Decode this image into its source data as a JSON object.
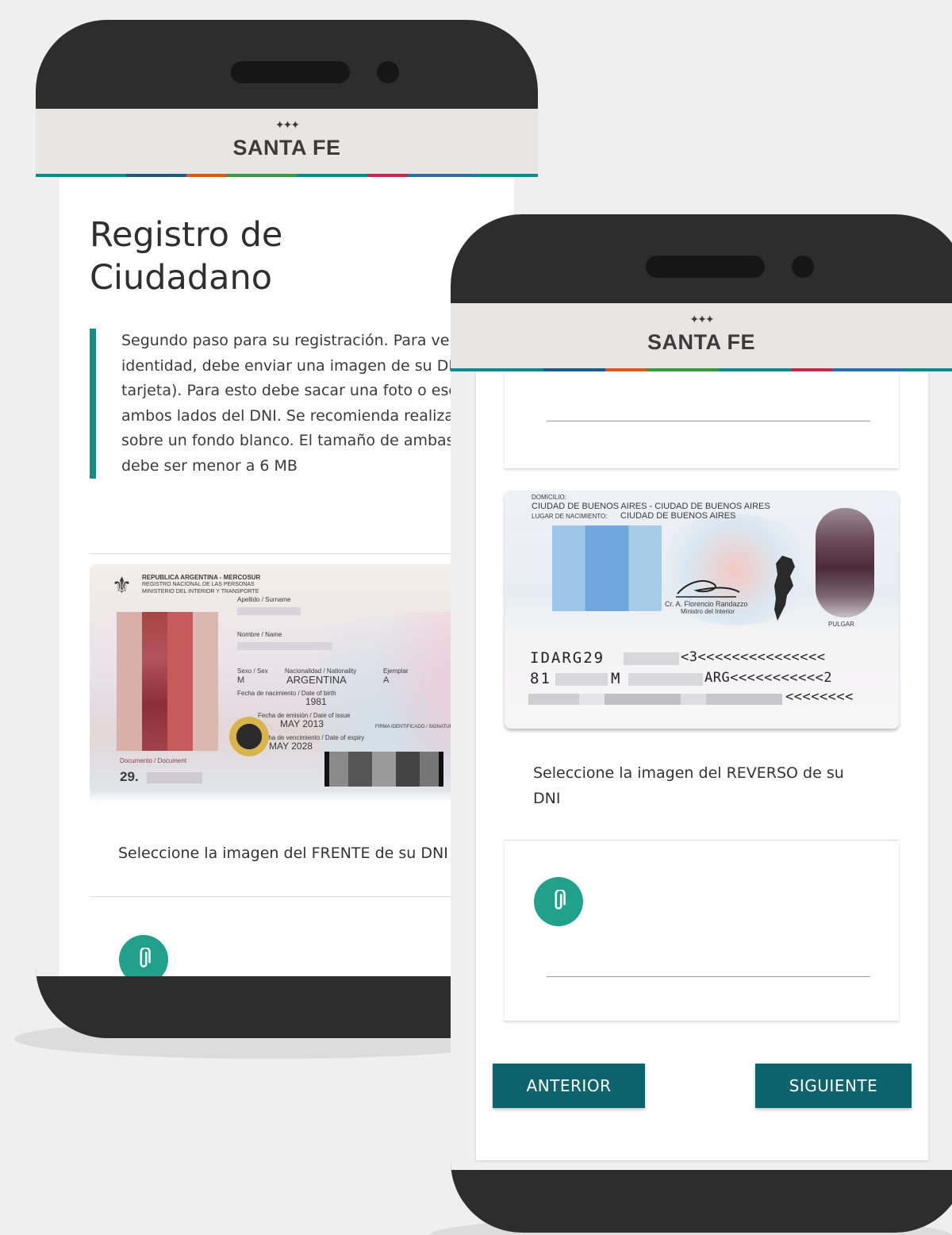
{
  "brand": {
    "name": "SANTA FE",
    "stars": "✦✦✦"
  },
  "phone1": {
    "title_line1": "Registro de",
    "title_line2": "Ciudadano",
    "description": "Segundo paso para su registración. Para verificar su identidad, debe enviar una imagen de su DNI (sólo tarjeta). Para esto debe sacar una foto o escanear ambos lados del DNI. Se recomienda realizar las fotos sobre un fondo blanco. El tamaño de ambas imagenes debe ser menor a 6 MB",
    "dni_front": {
      "header1": "REPUBLICA ARGENTINA - MERCOSUR",
      "header2": "REGISTRO NACIONAL DE LAS PERSONAS",
      "header3": "MINISTERIO DEL INTERIOR Y TRANSPORTE",
      "surname_label": "Apellido / Surname",
      "name_label": "Nombre / Name",
      "sex_label": "Sexo / Sex",
      "sex_value": "M",
      "nationality_label": "Nacionalidad / Nationality",
      "nationality_value": "ARGENTINA",
      "copy_label": "Ejemplar",
      "copy_value": "A",
      "birth_label": "Fecha de nacimiento / Date of birth",
      "birth_value": "1981",
      "issue_label": "Fecha de emisión / Date of issue",
      "issue_value": "MAY 2013",
      "expiry_label": "Fecha de vencimiento / Date of expiry",
      "expiry_value": "MAY 2028",
      "document_label": "Documento / Document",
      "document_value": "29.",
      "signature_label": "FIRMA IDENTIFICADO / SIGNATURE"
    },
    "front_caption": "Seleccione la imagen del FRENTE de su DNI"
  },
  "phone2": {
    "dni_back": {
      "address_label": "DOMICILIO:",
      "address_value": "CIUDAD DE BUENOS AIRES - CIUDAD DE BUENOS AIRES",
      "birthplace_label": "LUGAR DE NACIMIENTO:",
      "birthplace_value": "CIUDAD DE BUENOS AIRES",
      "signer_name": "Cr. A. Florencio Randazzo",
      "signer_title": "Ministro del Interior",
      "thumb_label": "PULGAR",
      "mrz_line1_start": "IDARG29",
      "mrz_line1_end": "<3<<<<<<<<<<<<<<<",
      "mrz_line2_start": "81",
      "mrz_line2_mid": "M",
      "mrz_line2_end": "ARG<<<<<<<<<<<2",
      "mrz_line3_end": "<<<<<<<<"
    },
    "back_caption": "Seleccione la imagen del REVERSO de su DNI",
    "prev_button": "ANTERIOR",
    "next_button": "SIGUIENTE"
  },
  "colors": {
    "accent": "#21a18b",
    "button": "#0e646c",
    "quote_bar": "#1a8a86",
    "phone_body": "#2d2d2d"
  },
  "icons": {
    "attach": "paperclip-icon"
  }
}
